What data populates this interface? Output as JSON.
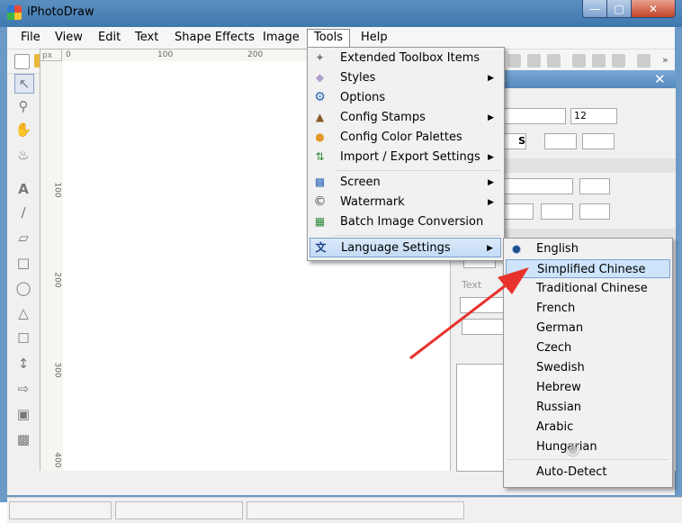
{
  "window": {
    "title": "iPhotoDraw"
  },
  "menubar": {
    "items": [
      "File",
      "View",
      "Edit",
      "Text",
      "Shape Effects",
      "Image",
      "Tools",
      "Help"
    ]
  },
  "ruler": {
    "unit": "px",
    "top_labels": [
      "0",
      "100",
      "200"
    ],
    "left_labels": [
      "100",
      "200",
      "300",
      "400"
    ]
  },
  "tools_menu": {
    "items": [
      {
        "label": "Extended Toolbox Items",
        "submenu": false,
        "icon": "wand-icon"
      },
      {
        "label": "Styles",
        "submenu": true,
        "icon": "styles-icon"
      },
      {
        "label": "Options",
        "submenu": false,
        "icon": "gear-icon"
      },
      {
        "label": "Config Stamps",
        "submenu": true,
        "icon": "stamp-icon"
      },
      {
        "label": "Config Color Palettes",
        "submenu": false,
        "icon": "palette-icon"
      },
      {
        "label": "Import / Export Settings",
        "submenu": true,
        "icon": "import-export-icon"
      },
      {
        "label": "Screen",
        "submenu": true,
        "icon": "screen-icon"
      },
      {
        "label": "Watermark",
        "submenu": true,
        "icon": "copyright-icon"
      },
      {
        "label": "Batch Image Conversion",
        "submenu": false,
        "icon": "batch-icon"
      },
      {
        "label": "Language Settings",
        "submenu": true,
        "icon": "language-icon",
        "highlighted": true
      }
    ]
  },
  "language_menu": {
    "selected": "English",
    "hovered": "Simplified Chinese",
    "items": [
      "English",
      "Simplified Chinese",
      "Traditional Chinese",
      "French",
      "German",
      "Czech",
      "Swedish",
      "Hebrew",
      "Russian",
      "Arabic",
      "Hungarian",
      "Auto-Detect"
    ]
  },
  "right_panel": {
    "font_size": "12",
    "text_label": "Text"
  },
  "colors": {
    "title_bar": "#3e78ad",
    "highlight": "#cde4fb",
    "arrow": "#e8322c"
  }
}
